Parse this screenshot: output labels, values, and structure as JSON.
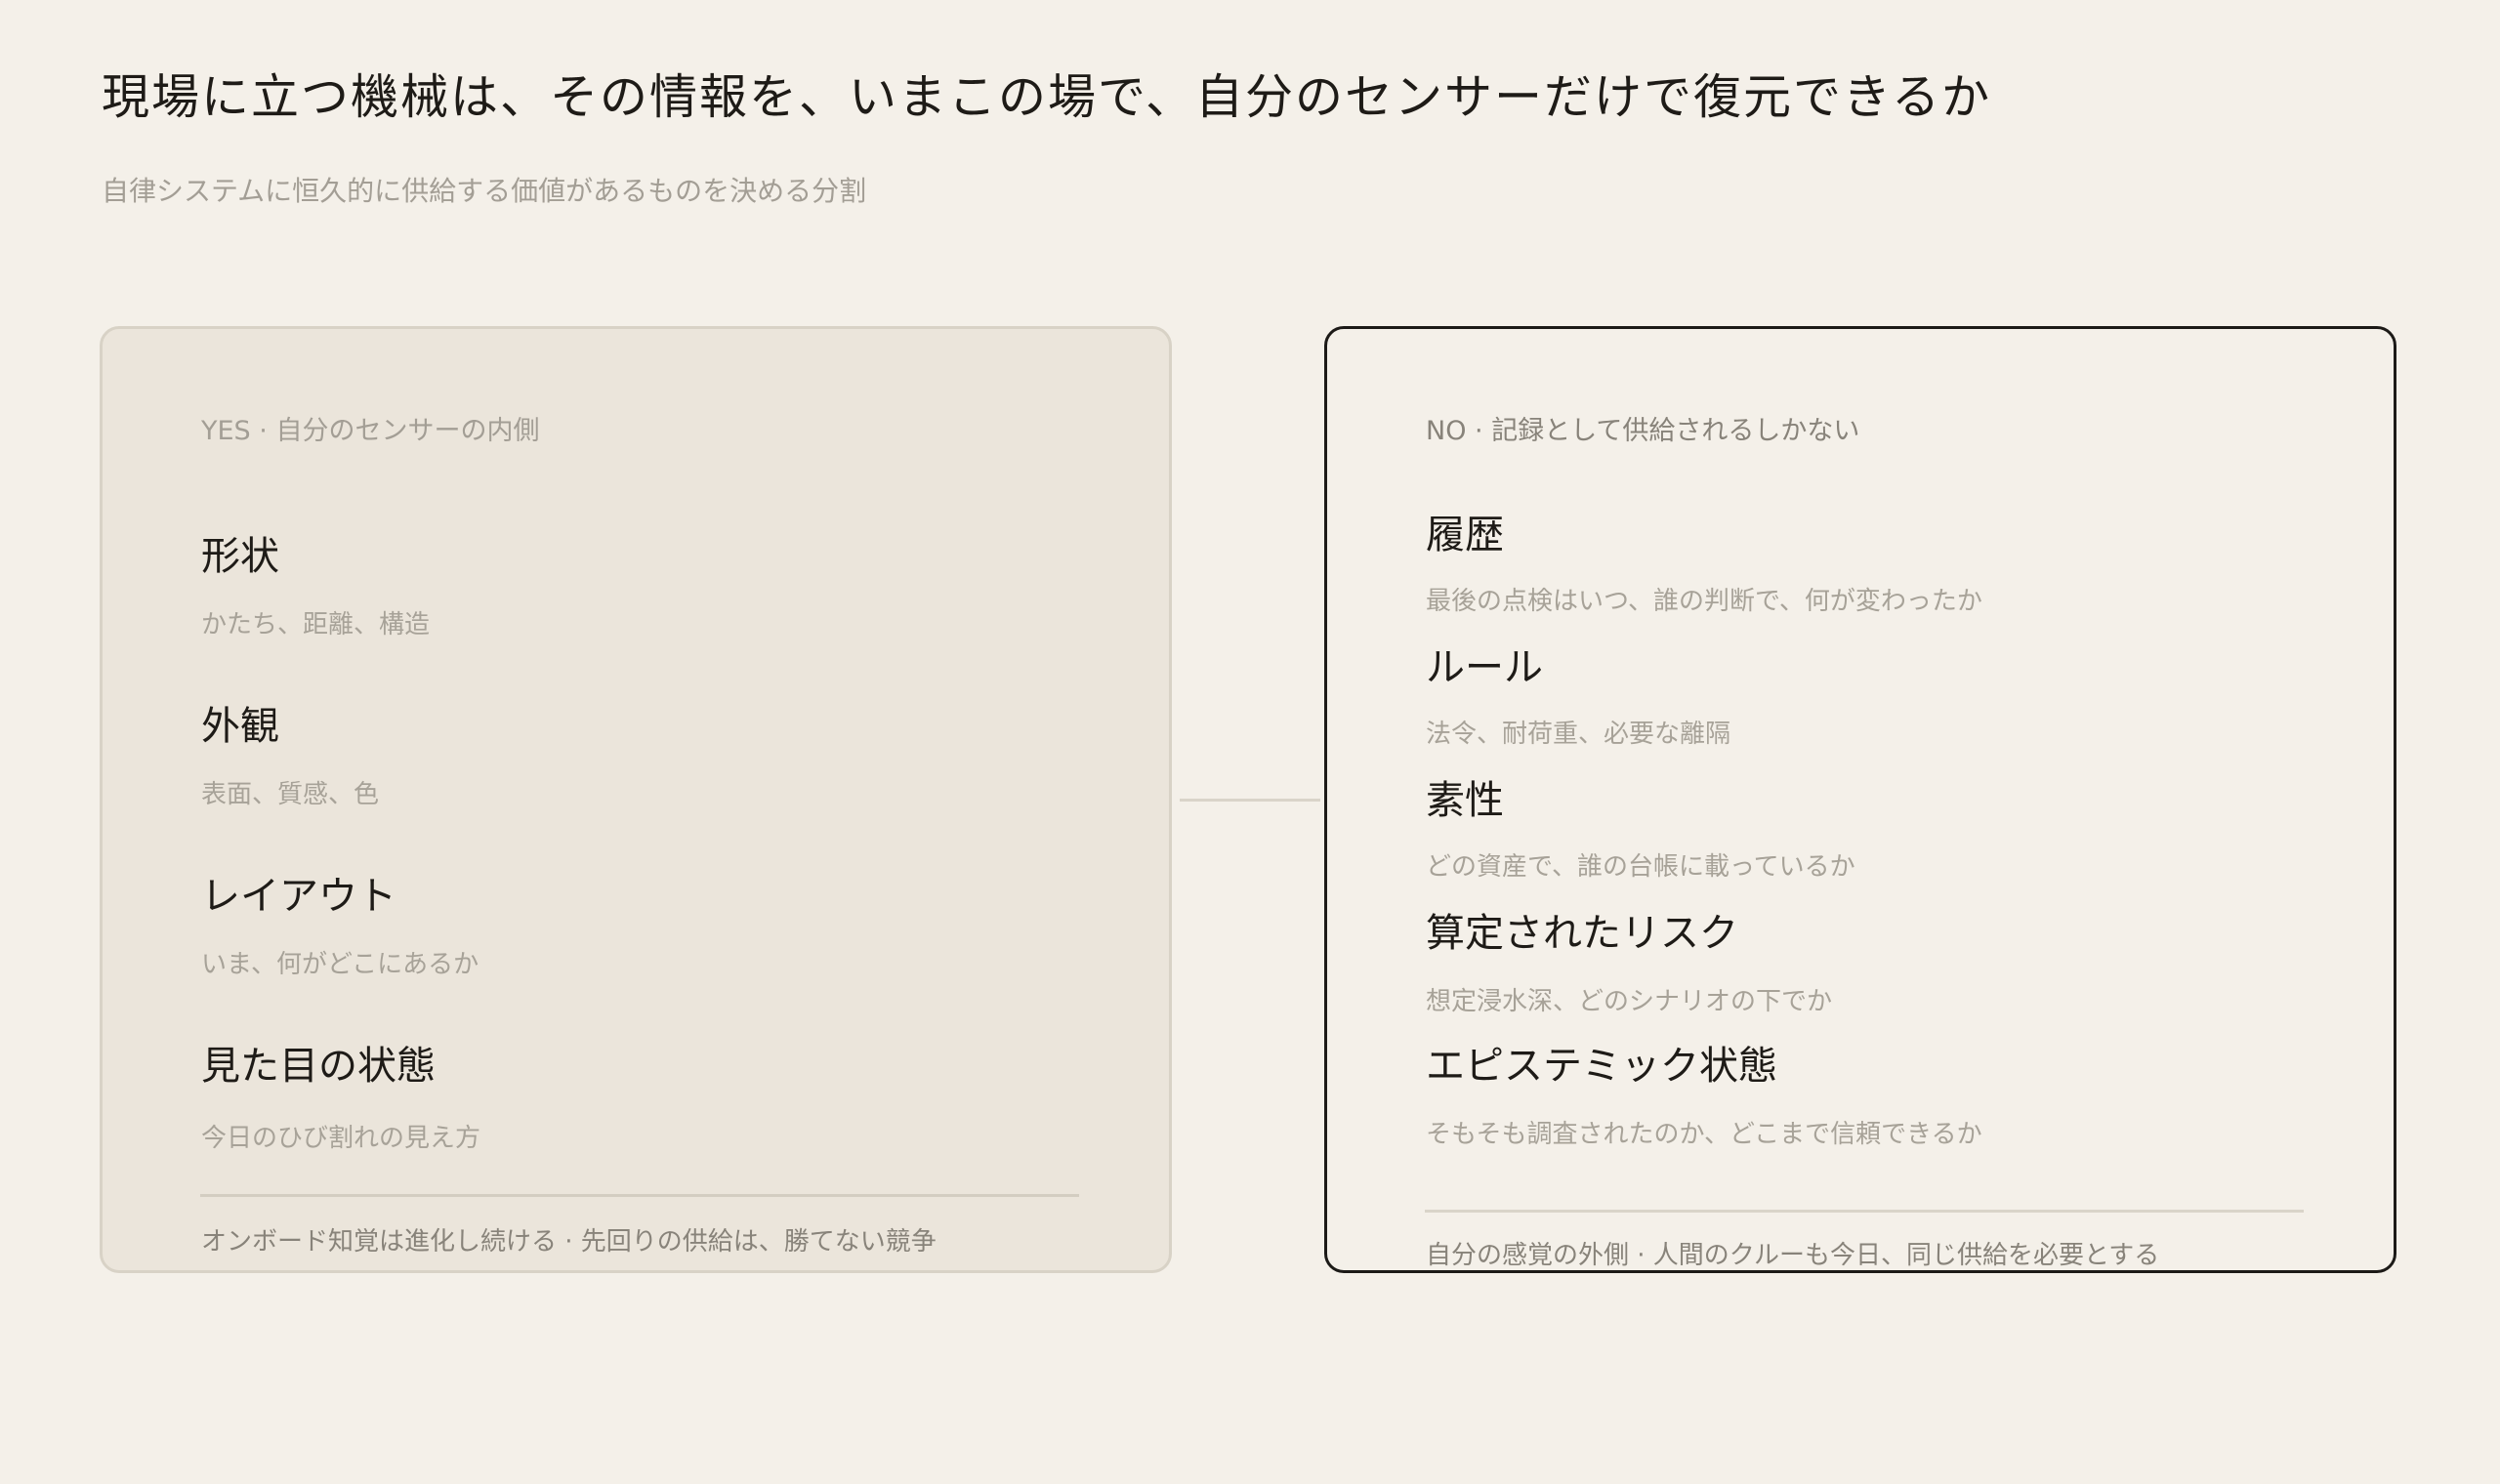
{
  "header": {
    "title": "現場に立つ機械は、その情報を、いまこの場で、自分のセンサーだけで復元できるか",
    "subtitle": "自律システムに恒久的に供給する価値があるものを決める分割"
  },
  "left_panel": {
    "label": "YES · 自分のセンサーの内側",
    "items": [
      {
        "title": "形状",
        "desc": "かたち、距離、構造"
      },
      {
        "title": "外観",
        "desc": "表面、質感、色"
      },
      {
        "title": "レイアウト",
        "desc": "いま、何がどこにあるか"
      },
      {
        "title": "見た目の状態",
        "desc": "今日のひび割れの見え方"
      }
    ],
    "footer": "オンボード知覚は進化し続ける · 先回りの供給は、勝てない競争"
  },
  "right_panel": {
    "label": "NO · 記録として供給されるしかない",
    "items": [
      {
        "title": "履歴",
        "desc": "最後の点検はいつ、誰の判断で、何が変わったか"
      },
      {
        "title": "ルール",
        "desc": "法令、耐荷重、必要な離隔"
      },
      {
        "title": "素性",
        "desc": "どの資産で、誰の台帳に載っているか"
      },
      {
        "title": "算定されたリスク",
        "desc": "想定浸水深、どのシナリオの下でか"
      },
      {
        "title": "エピステミック状態",
        "desc": "そもそも調査されたのか、どこまで信頼できるか"
      }
    ],
    "footer": "自分の感覚の外側 · 人間のクルーも今日、同じ供給を必要とする"
  }
}
